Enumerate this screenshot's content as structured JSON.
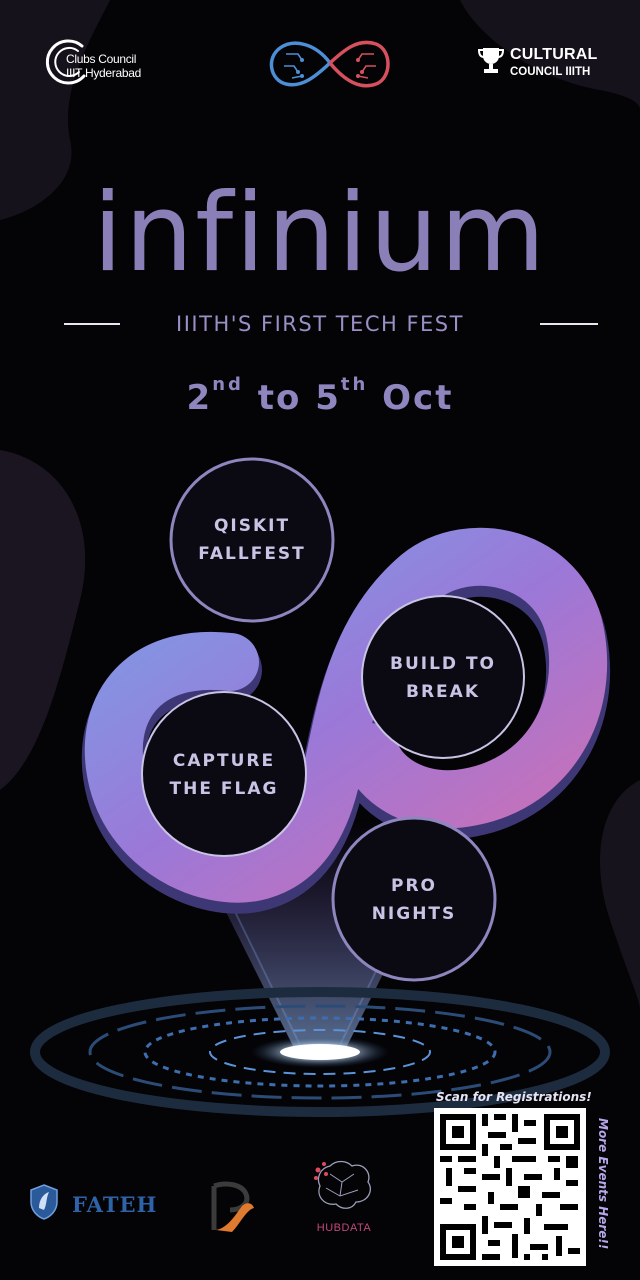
{
  "header": {
    "left_logo_line1": "Clubs Council",
    "left_logo_line2": "IIIT Hyderabad",
    "center_logo_icon": "infinity-circuit-icon",
    "right_logo_line1": "CULTURAL",
    "right_logo_line2": "COUNCIL IIITH",
    "right_logo_icon": "trophy-icon"
  },
  "hero": {
    "title": "infinium",
    "tagline": "IIITH'S FIRST TECH FEST",
    "date_start_num": "2",
    "date_start_suffix": "nd",
    "date_to": "to",
    "date_end_num": "5",
    "date_end_suffix": "th",
    "date_month": "Oct"
  },
  "events": [
    {
      "line1": "QISKIT",
      "line2": "FALLFEST"
    },
    {
      "line1": "BUILD TO",
      "line2": "BREAK"
    },
    {
      "line1": "CAPTURE",
      "line2": "THE FLAG"
    },
    {
      "line1": "PRO",
      "line2": "NIGHTS"
    }
  ],
  "sponsors": {
    "fateh_name": "FATEH",
    "hubdata_name": "HUBDATA"
  },
  "qr": {
    "caption": "Scan for Registrations!",
    "side_text": "More Events Here!!"
  },
  "colors": {
    "accent_purple": "#8b7fb8",
    "magenta": "#b65ad0",
    "blue": "#5f8bd6",
    "background": "#040306"
  }
}
